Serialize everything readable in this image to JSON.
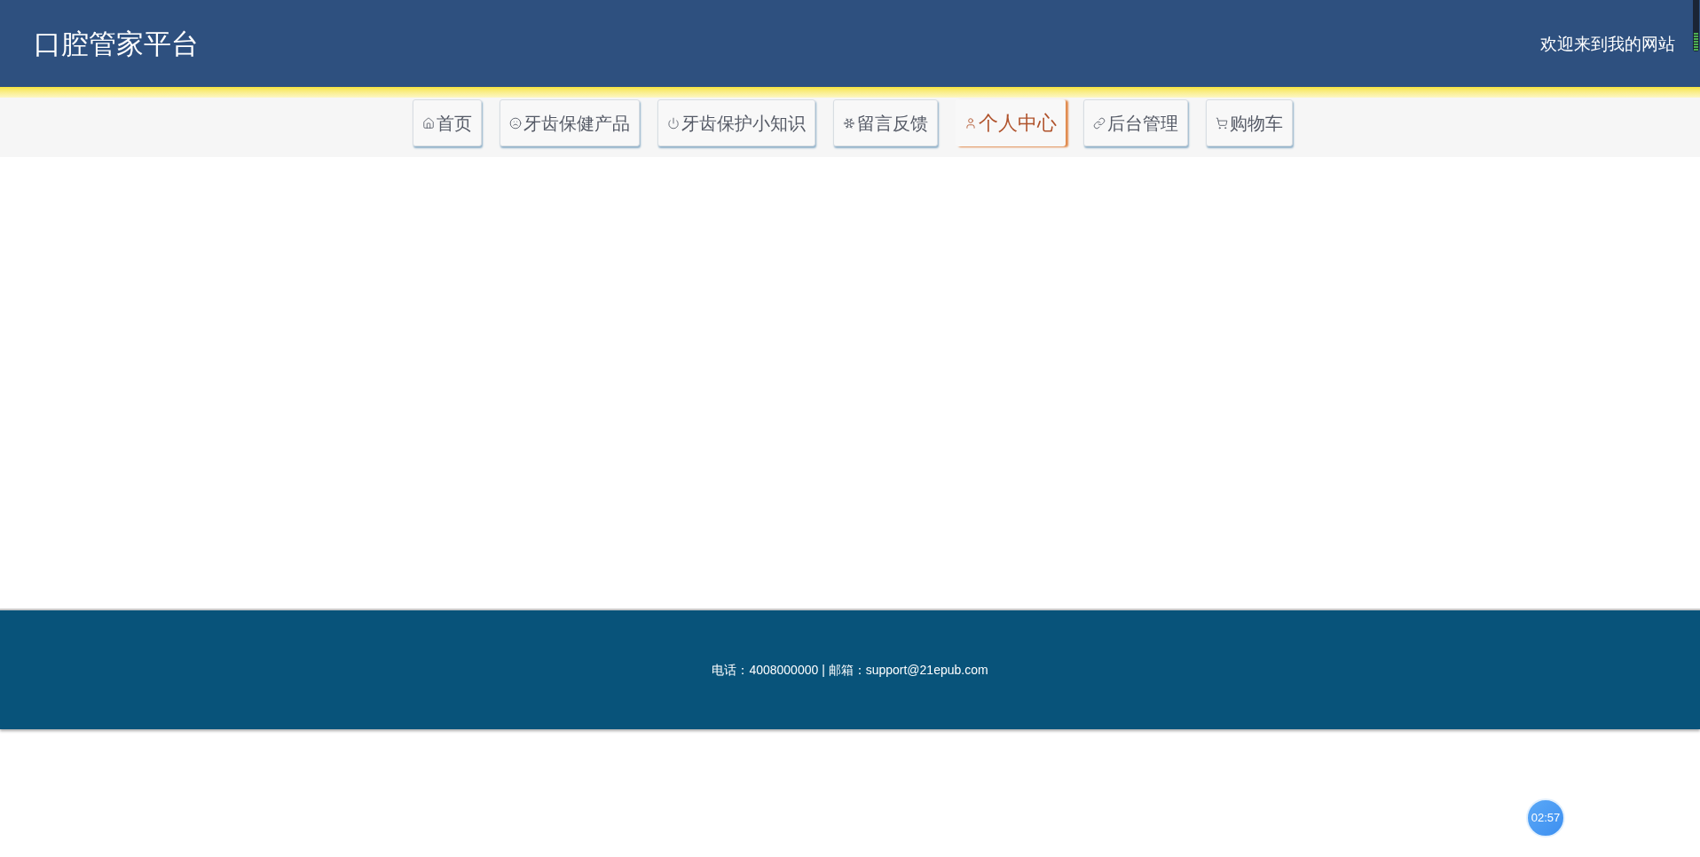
{
  "header": {
    "title": "口腔管家平台",
    "welcome": "欢迎来到我的网站"
  },
  "nav": [
    {
      "label": "首页",
      "kind": "home",
      "selected": false
    },
    {
      "label": "牙齿保健产品",
      "kind": "products",
      "selected": false
    },
    {
      "label": "牙齿保护小知识",
      "kind": "tips",
      "selected": false
    },
    {
      "label": "留言反馈",
      "kind": "feedback",
      "selected": false
    },
    {
      "label": "个人中心",
      "kind": "account",
      "selected": true
    },
    {
      "label": "后台管理",
      "kind": "admin",
      "selected": false
    },
    {
      "label": "购物车",
      "kind": "cart",
      "selected": false
    }
  ],
  "footer": {
    "contact": "电话：4008000000 | 邮箱：support@21epub.com"
  },
  "timer": "02:57"
}
